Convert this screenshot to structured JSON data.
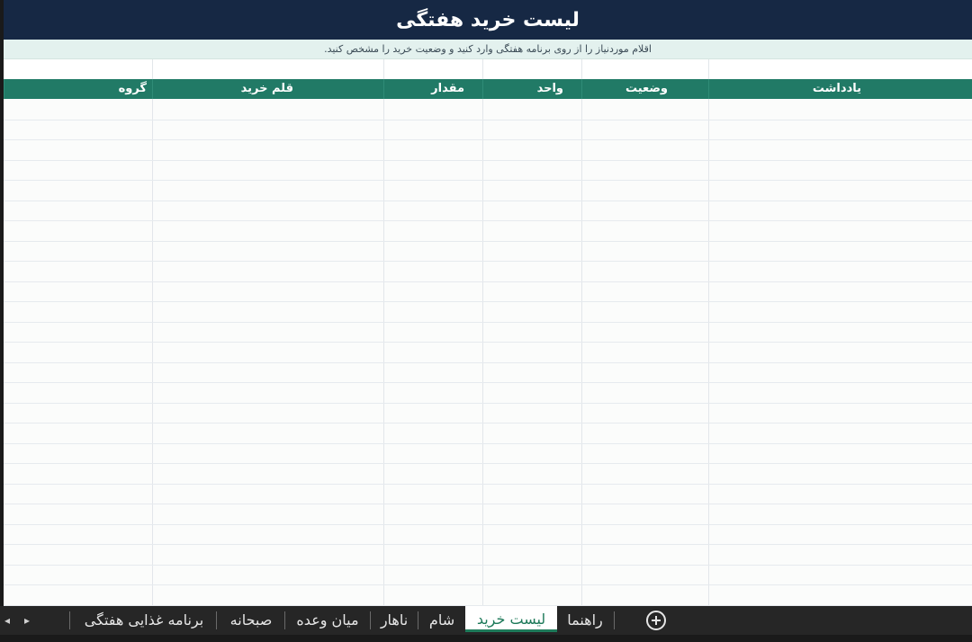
{
  "sheet": {
    "title": "لیست خرید هفتگی",
    "subtitle": "اقلام موردنیاز را از روی برنامه هفتگی وارد کنید و وضعیت خرید را مشخص کنید.",
    "columns": [
      {
        "key": "group",
        "label": "گروه"
      },
      {
        "key": "item",
        "label": "قلم خرید"
      },
      {
        "key": "quantity",
        "label": "مقدار"
      },
      {
        "key": "unit",
        "label": "واحد"
      },
      {
        "key": "status",
        "label": "وضعیت"
      },
      {
        "key": "note",
        "label": "یادداشت"
      }
    ],
    "colors": {
      "title_bg": "#162844",
      "subtitle_bg": "#e3f1ee",
      "header_bg": "#217a66",
      "active_tab": "#1e7a5a"
    }
  },
  "tabs": {
    "items": [
      {
        "label": "برنامه غذایی هفتگی"
      },
      {
        "label": "صبحانه"
      },
      {
        "label": "میان وعده"
      },
      {
        "label": "ناهار"
      },
      {
        "label": "شام"
      },
      {
        "label": "لیست خرید",
        "active": true
      },
      {
        "label": "راهنما"
      }
    ],
    "icons": [
      "prev-sheet-arrow",
      "next-sheet-arrow",
      "add-sheet-plus-icon"
    ]
  }
}
